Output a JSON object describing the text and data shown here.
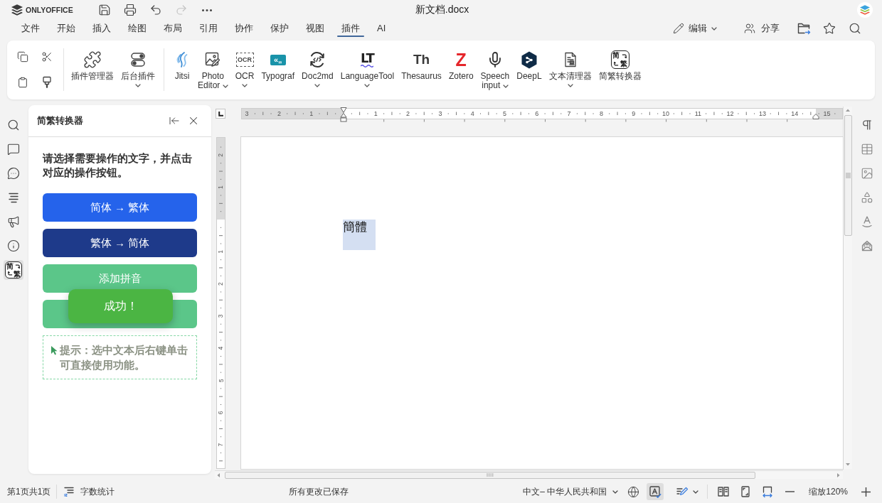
{
  "title_bar": {
    "logo_text": "ONLYOFFICE",
    "quick_access": [
      {
        "disabled": false
      },
      {
        "disabled": false
      },
      {
        "disabled": false
      },
      {
        "disabled": true
      },
      {
        "disabled": false
      }
    ],
    "document_title": "新文档.docx"
  },
  "menu_tabs": [
    {
      "label": "文件",
      "selected": false
    },
    {
      "label": "开始",
      "selected": false
    },
    {
      "label": "插入",
      "selected": false
    },
    {
      "label": "绘图",
      "selected": false
    },
    {
      "label": "布局",
      "selected": false
    },
    {
      "label": "引用",
      "selected": false
    },
    {
      "label": "协作",
      "selected": false
    },
    {
      "label": "保护",
      "selected": false
    },
    {
      "label": "视图",
      "selected": false
    },
    {
      "label": "插件",
      "selected": true
    },
    {
      "label": "AI",
      "selected": false
    }
  ],
  "header_actions": {
    "edit_mode": "编辑",
    "share": "分享"
  },
  "toolbar": {
    "manager_buttons": [
      {
        "label": "插件管理器",
        "dropdown": false
      },
      {
        "label": "后台插件",
        "dropdown": true
      }
    ],
    "plugins": [
      {
        "label": "Jitsi",
        "dropdown": false
      },
      {
        "label": "Photo Editor",
        "dropdown": true
      },
      {
        "label": "OCR",
        "dropdown": true,
        "logo_text": "OCR"
      },
      {
        "label": "Typograf",
        "dropdown": false,
        "logo_text": "«„"
      },
      {
        "label": "Doc2md",
        "dropdown": true
      },
      {
        "label": "LanguageTool",
        "dropdown": true,
        "logo_text": "LT"
      },
      {
        "label": "Thesaurus",
        "dropdown": false,
        "logo_text": "Th"
      },
      {
        "label": "Zotero",
        "dropdown": false,
        "logo_text": "Z"
      },
      {
        "label": "Speech input",
        "dropdown": true
      },
      {
        "label": "DeepL",
        "dropdown": false
      },
      {
        "label": "文本清理器",
        "dropdown": true
      },
      {
        "label": "简繁转换器",
        "dropdown": false,
        "logo_text": [
          "简",
          "繁"
        ]
      }
    ]
  },
  "left_rail": [
    {
      "selected": false
    },
    {
      "selected": false
    },
    {
      "selected": false
    },
    {
      "selected": false
    },
    {
      "selected": false
    },
    {
      "selected": false
    },
    {
      "selected": true,
      "logo_text": [
        "简",
        "繁"
      ]
    }
  ],
  "plugin_panel": {
    "title": "简繁转换器",
    "instruction": "请选择需要操作的文字，并点击对应的操作按钮。",
    "buttons": [
      {
        "label": "简体 → 繁体",
        "color": "#2563eb"
      },
      {
        "label": "繁体 → 简体",
        "color": "#1e3a8a"
      },
      {
        "label": "添加拼音",
        "color": "#5bc689"
      },
      {
        "color": "#5bc689"
      }
    ],
    "toast": {
      "text": "成功！"
    },
    "hint": "提示：选中文本后右键单击可直接使用功能。"
  },
  "horizontal_ruler": {
    "before_zero": [
      "3",
      "2",
      "1"
    ],
    "after_zero": [
      "1",
      "2",
      "3",
      "4",
      "5",
      "6",
      "7",
      "8",
      "9",
      "10",
      "11",
      "12",
      "13",
      "14",
      "15"
    ]
  },
  "vertical_ruler": {
    "before_zero": [
      "2",
      "1"
    ],
    "after_zero": [
      "1",
      "2",
      "3",
      "4",
      "5",
      "6",
      "7"
    ]
  },
  "document": {
    "text": "簡體",
    "highlighted": true
  },
  "status_bar": {
    "page_info": "第1页共1页",
    "word_count": "字数统计",
    "save_status": "所有更改已保存",
    "language": "中文– 中华人民共和国",
    "spellcheck_on": true,
    "zoom": "缩放120%"
  }
}
